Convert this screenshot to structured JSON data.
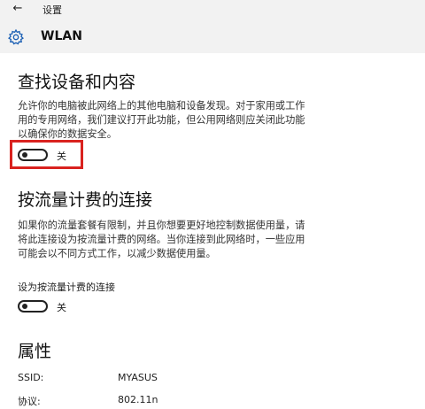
{
  "titlebar": {
    "back_icon": "back-arrow-icon",
    "app_title": "设置"
  },
  "header": {
    "icon": "gear-icon",
    "title": "WLAN"
  },
  "discovery": {
    "heading": "查找设备和内容",
    "desc_line1": "允许你的电脑被此网络上的其他电脑和设备发现。对于家用或工作",
    "desc_line2": "用的专用网络，我们建议打开此功能，但公用网络则应关闭此功能",
    "desc_line3": "以确保你的数据安全。",
    "toggle_state": "off",
    "toggle_label": "关"
  },
  "metered": {
    "heading": "按流量计费的连接",
    "desc_line1": "如果你的流量套餐有限制，并且你想要更好地控制数据使用量，请",
    "desc_line2": "将此连接设为按流量计费的网络。当你连接到此网络时，一些应用",
    "desc_line3": "可能会以不同方式工作，以减少数据使用量。",
    "setting_label": "设为按流量计费的连接",
    "toggle_state": "off",
    "toggle_label": "关"
  },
  "properties": {
    "heading": "属性",
    "rows": [
      {
        "key": "SSID:",
        "value": "MYASUS"
      },
      {
        "key": "协议:",
        "value": "802.11n"
      }
    ]
  },
  "colors": {
    "highlight": "#d9221f",
    "header_bg": "#f2f2f2"
  }
}
